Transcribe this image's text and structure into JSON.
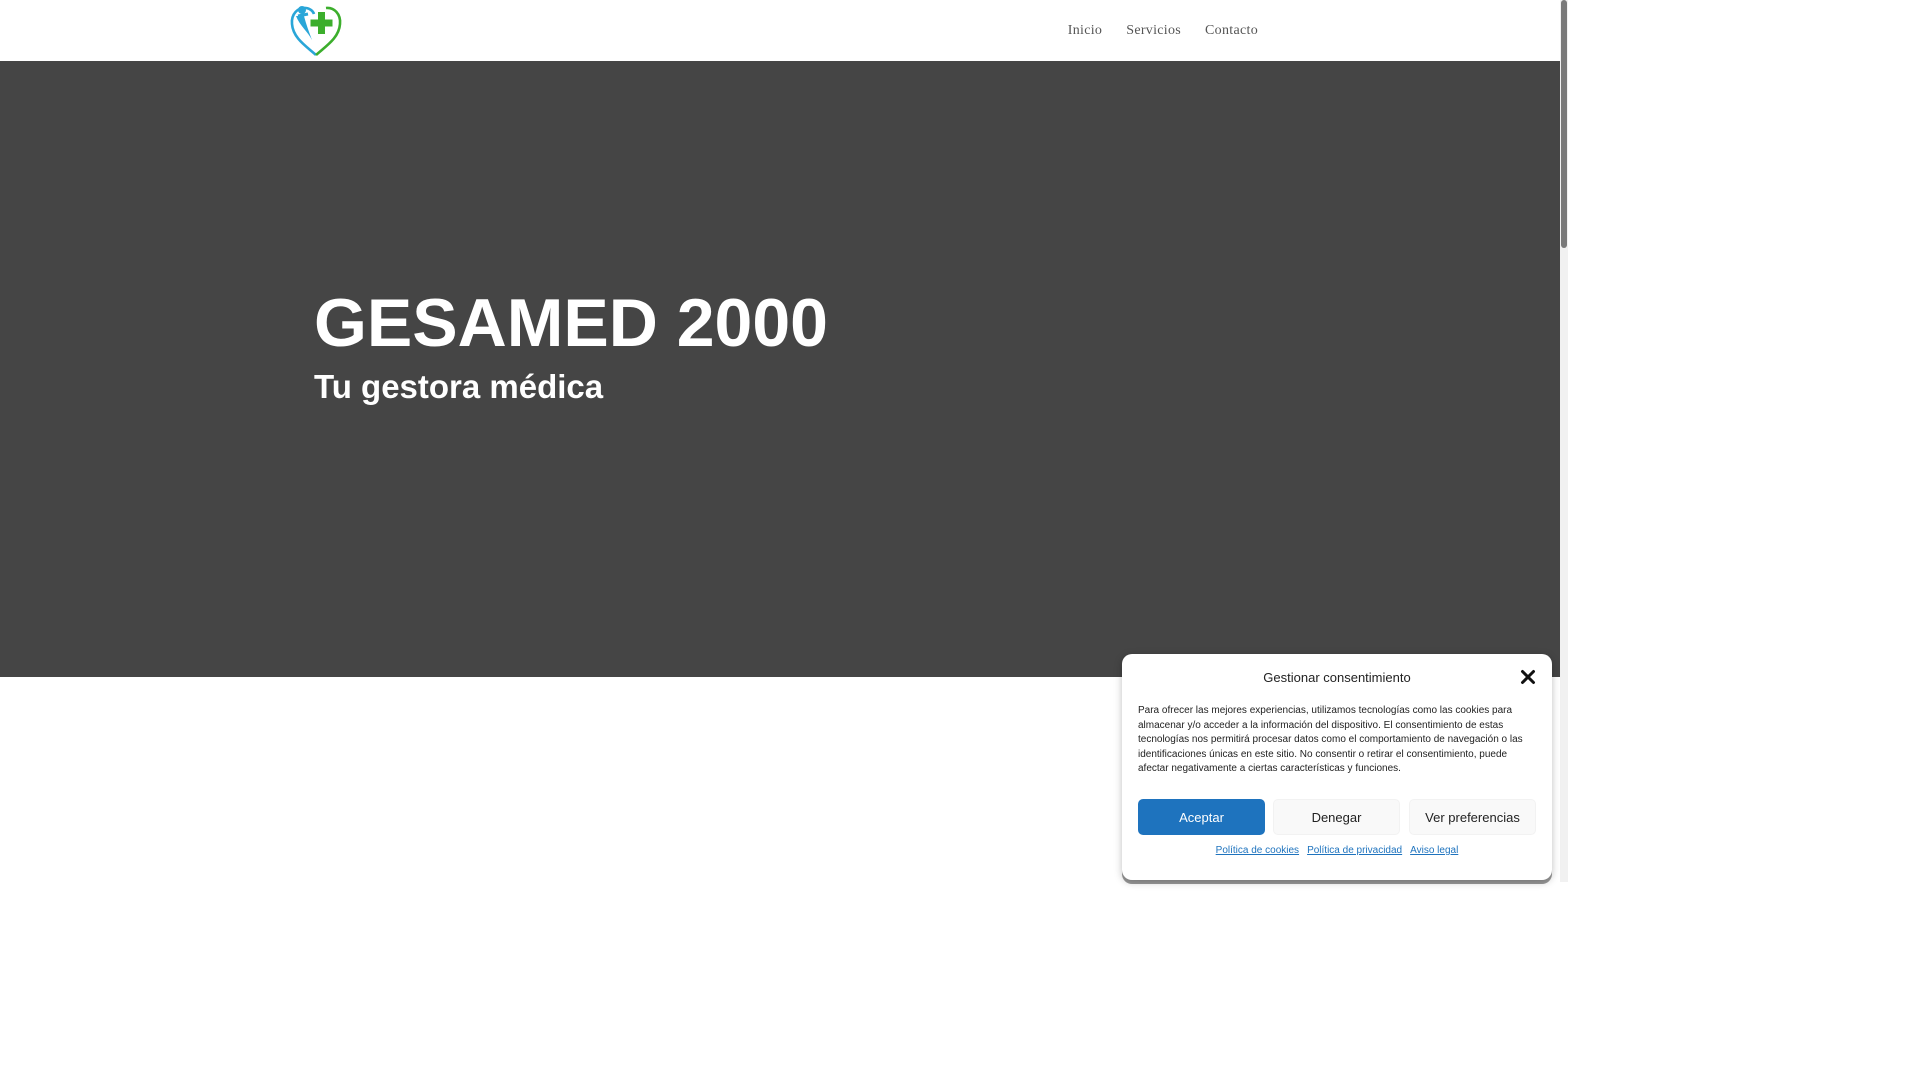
{
  "header": {
    "nav": [
      {
        "label": "Inicio"
      },
      {
        "label": "Servicios"
      },
      {
        "label": "Contacto"
      }
    ]
  },
  "hero": {
    "title": "GESAMED 2000",
    "subtitle": "Tu gestora médica",
    "background_color": "#454545"
  },
  "logo": {
    "icon": "heart-cross-logo",
    "colors": [
      "#2aa6d8",
      "#3cae2c"
    ]
  },
  "cookie_banner": {
    "title": "Gestionar consentimiento",
    "text": "Para ofrecer las mejores experiencias, utilizamos tecnologías como las cookies para almacenar y/o acceder a la información del dispositivo. El consentimiento de estas tecnologías nos permitirá procesar datos como el comportamiento de navegación o las identificaciones únicas en este sitio. No consentir o retirar el consentimiento, puede afectar negativamente a ciertas características y funciones.",
    "buttons": {
      "accept": "Aceptar",
      "deny": "Denegar",
      "preferences": "Ver preferencias"
    },
    "links": {
      "cookies": "Política de cookies",
      "privacy": "Política de privacidad",
      "legal": "Aviso legal"
    },
    "accent_color": "#1e73be"
  }
}
